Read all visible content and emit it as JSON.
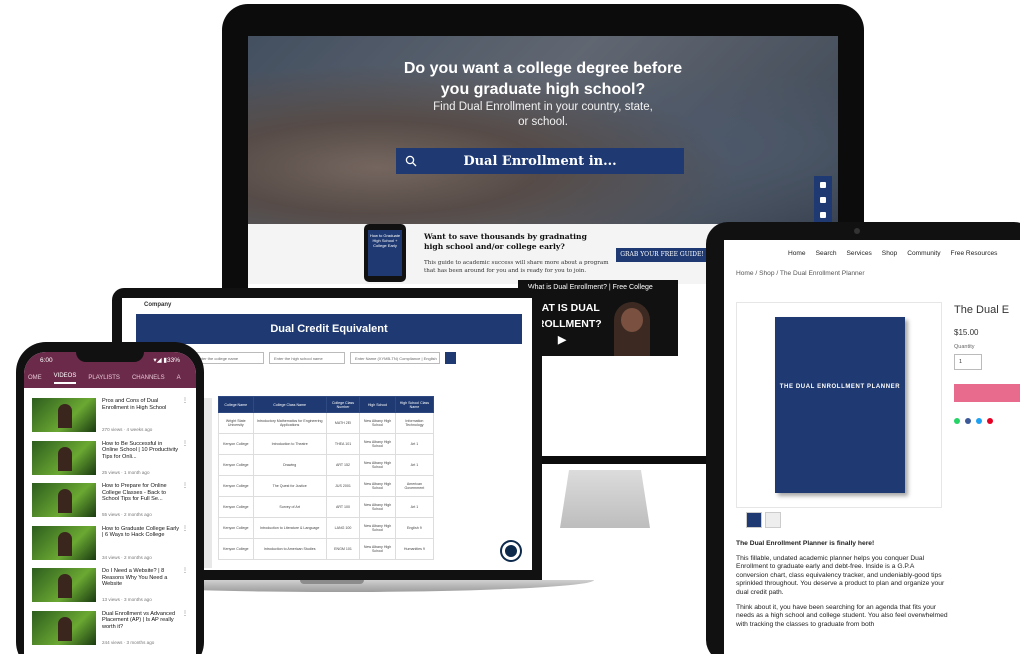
{
  "monitor": {
    "hero_title": "Do you want a college degree before you graduate high school?",
    "hero_sub": "Find Dual Enrollment in your country, state, or school.",
    "search_text": "Dual Enrollment in...",
    "promo": {
      "book_text": "How to Graduate High School + College Early",
      "title": "Want to save thousands by gradnating high school and/or college early?",
      "body": "This guide to academic success will share more about a program that has been around for you and is ready for you to join.",
      "button": "GRAB YOUR FREE GUIDE!"
    },
    "video": {
      "title": "What is Dual Enrollment? | Free College",
      "big_text": "WHAT IS DUAL ENROLLMENT? ▶"
    }
  },
  "laptop": {
    "company": "Company",
    "banner": "Dual Credit Equivalent",
    "filters": [
      "Enter the college name",
      "Enter the high school name",
      "Enter Name (XYMB-TN) Compliance | English"
    ],
    "table": {
      "headers": [
        "College Name",
        "College Class Name",
        "College Class Number",
        "High School",
        "High School Class Name"
      ],
      "rows": [
        [
          "Wright State University",
          "Introductory Mathematics for Engineering Applications",
          "MATH 2EI",
          "New Albany High School",
          "Information Technology"
        ],
        [
          "Kenyon College",
          "Introduction to Theatre",
          "THEA 101",
          "New Albany High School",
          "Art 1"
        ],
        [
          "Kenyon College",
          "Drawing",
          "ART 152",
          "New Albany High School",
          "Art 1"
        ],
        [
          "Kenyon College",
          "The Quest for Justice",
          "JUS 2001",
          "New Albany High School",
          "American Government"
        ],
        [
          "Kenyon College",
          "Survey of Art",
          "ART 100",
          "New Albany High School",
          "Art 1"
        ],
        [
          "Kenyon College",
          "Introduction to Literature & Language",
          "LANG 100",
          "New Albany High School",
          "English 9"
        ],
        [
          "Kenyon College",
          "Introduction to American Studies",
          "ENGM 101",
          "New Albany High School",
          "Humanities 9"
        ]
      ]
    }
  },
  "tablet": {
    "nav": [
      "Home",
      "Search",
      "Services",
      "Shop",
      "Community",
      "Free Resources"
    ],
    "breadcrumb": "Home / Shop / The Dual Enrollment Planner",
    "book_title": "THE DUAL ENROLLMENT PLANNER",
    "product_title": "The Dual E",
    "price": "$15.00",
    "quantity_label": "Quantity",
    "quantity_value": "1",
    "desc_heading": "The Dual Enrollment Planner is finally here!",
    "desc_p1": "This fillable, undated academic planner helps you conquer Dual Enrollment to graduate early and debt-free. Inside is a G.P.A conversion chart, class equivalency tracker, and undeniably-good tips sprinkled throughout. You deserve a product to plan and organize your dual credit path.",
    "desc_p2": "Think about it, you have been searching for an agenda that fits your needs as a high school and college student. You also feel overwhelmed with tracking the classes to graduate from both"
  },
  "phone": {
    "time": "6:00",
    "status": "▾◢ ▮33%",
    "tabs": [
      "OME",
      "VIDEOS",
      "PLAYLISTS",
      "CHANNELS",
      "A"
    ],
    "active_tab": 1,
    "videos": [
      {
        "title": "Pros and Cons of Dual Enrollment in High School",
        "meta": "270 views · 4 weeks ago"
      },
      {
        "title": "How to Be Successful in Online School | 10 Productivity Tips for Onli...",
        "meta": "25 views · 1 month ago"
      },
      {
        "title": "How to Prepare for Online College Classes - Back to School Tips for Full Se...",
        "meta": "55 views · 2 months ago"
      },
      {
        "title": "How to Graduate College Early | 6 Ways to Hack College",
        "meta": "34 views · 2 months ago"
      },
      {
        "title": "Do I Need a Website? | 8 Reasons Why You Need a Website",
        "meta": "13 views · 3 months ago"
      },
      {
        "title": "Dual Enrollment vs Advanced Placement (AP) | Is AP really worth it?",
        "meta": "244 views · 3 months ago"
      }
    ]
  },
  "colors": {
    "navy": "#1f3a73",
    "plum": "#6b2a4a",
    "pink": "#e86a8c"
  }
}
